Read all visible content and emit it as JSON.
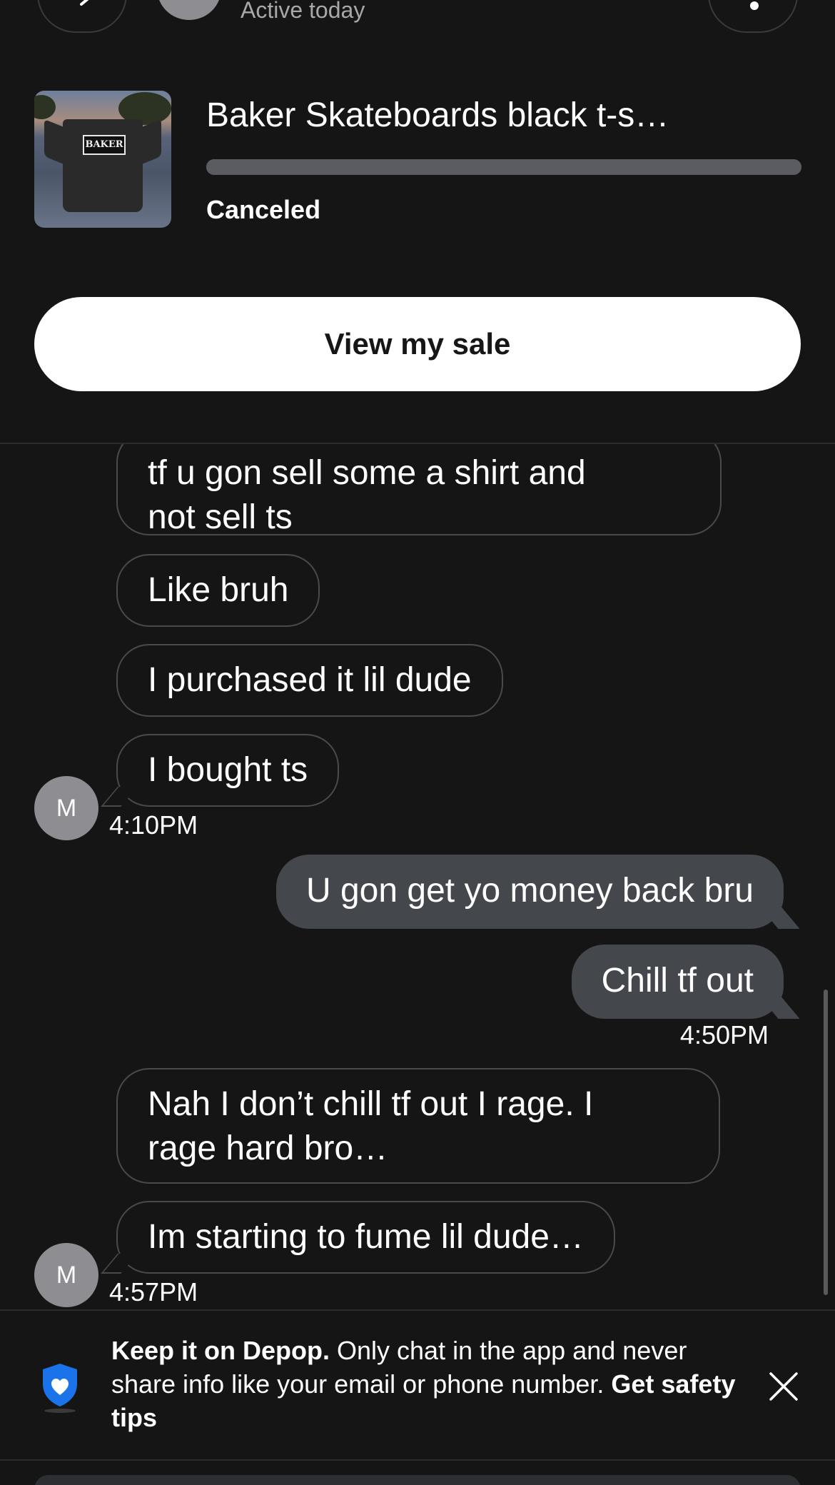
{
  "header": {
    "active_status": "Active today"
  },
  "item": {
    "title": "Baker Skateboards black t-s…",
    "status": "Canceled",
    "thumbnail_logo_text": "BAKER",
    "progress": 1.0,
    "progress_color": "#5a5c61"
  },
  "actions": {
    "view_sale_label": "View my sale"
  },
  "messages": [
    {
      "id": "m1",
      "side": "in",
      "lines": [
        "tf u gon sell some a shirt and",
        "not sell ts"
      ]
    },
    {
      "id": "m2",
      "side": "in",
      "lines": [
        "Like bruh"
      ]
    },
    {
      "id": "m3",
      "side": "in",
      "lines": [
        "I purchased it lil dude"
      ]
    },
    {
      "id": "m4",
      "side": "in",
      "lines": [
        "I bought ts"
      ]
    },
    {
      "id": "m5",
      "side": "out",
      "lines": [
        "U gon get yo money back bru"
      ]
    },
    {
      "id": "m6",
      "side": "out",
      "lines": [
        "Chill tf out"
      ]
    },
    {
      "id": "m7",
      "side": "in",
      "lines": [
        "Nah I don’t chill tf out I rage. I",
        "rage hard bro…"
      ]
    },
    {
      "id": "m8",
      "side": "in",
      "lines": [
        "Im starting to fume lil dude…"
      ]
    }
  ],
  "timestamps": {
    "t1": "4:10PM",
    "t2": "4:50PM",
    "t3": "4:57PM"
  },
  "avatar_initial": "M",
  "safety_banner": {
    "bold_lead": "Keep it on Depop.",
    "body": " Only chat in the app and never share info like your email or phone number. ",
    "link": "Get safety tips",
    "shield_color": "#1a73e8"
  },
  "colors": {
    "background": "#151515",
    "outgoing_bubble": "#44474b",
    "incoming_border": "#484a4e",
    "button_bg": "#ffffff"
  }
}
